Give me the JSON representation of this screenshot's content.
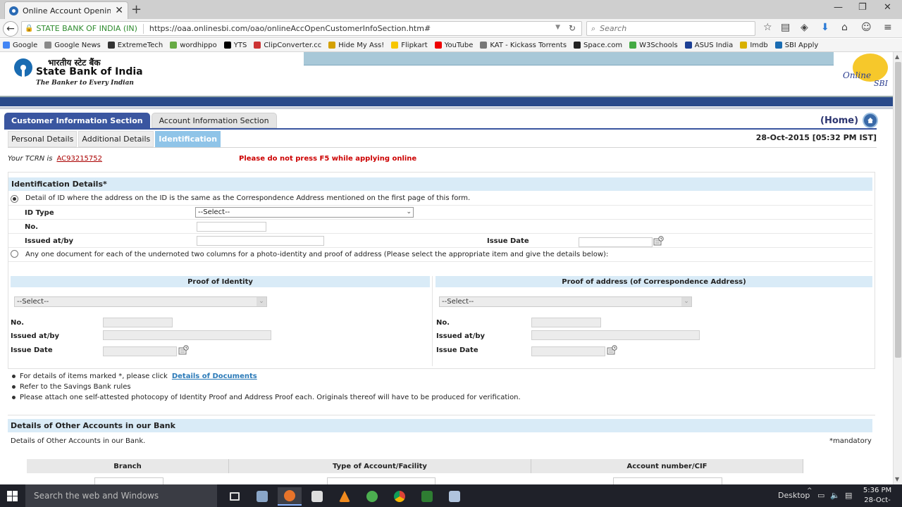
{
  "browser": {
    "tab_title": "Online Account Opening ...",
    "security_label": "STATE BANK OF INDIA (IN)",
    "url": "https://oaa.onlinesbi.com/oao/onlineAccOpenCustomerInfoSection.htm#",
    "search_placeholder": "Search",
    "bookmarks": [
      "Google",
      "Google News",
      "ExtremeTech",
      "wordhippo",
      "YTS",
      "ClipConverter.cc",
      "Hide My Ass!",
      "Flipkart",
      "YouTube",
      "KAT - Kickass Torrents",
      "Space.com",
      "W3Schools",
      "ASUS India",
      "Imdb",
      "SBI Apply"
    ]
  },
  "header": {
    "hindi_name": "भारतीय स्टेट बैंक",
    "bank_name": "State Bank of India",
    "tagline": "The Banker to Every Indian",
    "online_sbi_1": "Online",
    "online_sbi_2": "SBI"
  },
  "tabs": {
    "main": [
      "Customer Information Section",
      "Account Information Section"
    ],
    "sub": [
      "Personal Details",
      "Additional Details",
      "Identification"
    ],
    "home_label": "(Home)"
  },
  "meta": {
    "datetime": "28-Oct-2015 [05:32 PM IST]",
    "tcrn_label": "Your TCRN is",
    "tcrn_value": "AC93215752",
    "warning": "Please do not press F5 while applying online"
  },
  "identification": {
    "heading": "Identification Details*",
    "option1": "Detail of ID where the address on the ID is the same as the Correspondence Address mentioned on the first page of this form.",
    "id_type_label": "ID Type",
    "id_type_value": "--Select--",
    "no_label": "No.",
    "issued_label": "Issued at/by",
    "issue_date_label": "Issue Date",
    "option2": "Any one document for each of the undernoted two columns for a photo-identity and proof of address (Please select the appropriate item  and give the details below):",
    "proof_identity_heading": "Proof of Identity",
    "proof_address_heading": "Proof of address (of Correspondence Address)",
    "select_value": "--Select--"
  },
  "notes": {
    "note1_prefix": "For details of items marked *, please click",
    "note1_link": "Details of Documents",
    "note2": "Refer to the Savings Bank rules",
    "note3": "Please attach one self-attested photocopy of Identity Proof and Address Proof each. Originals thereof will have to be produced for verification."
  },
  "other_accounts": {
    "heading": "Details of Other Accounts in our Bank",
    "subtext": "Details of Other Accounts in our Bank.",
    "mandatory": "*mandatory",
    "columns": [
      "Branch",
      "Type of Account/Facility",
      "Account number/CIF"
    ]
  },
  "taskbar": {
    "search_placeholder": "Search the web and Windows",
    "desktop_label": "Desktop",
    "time": "5:36 PM",
    "date": "28-Oct-15"
  },
  "colors": {
    "active_tab": "#3a56a0",
    "section_bg": "#d9ebf7",
    "warning": "#cc0000"
  }
}
